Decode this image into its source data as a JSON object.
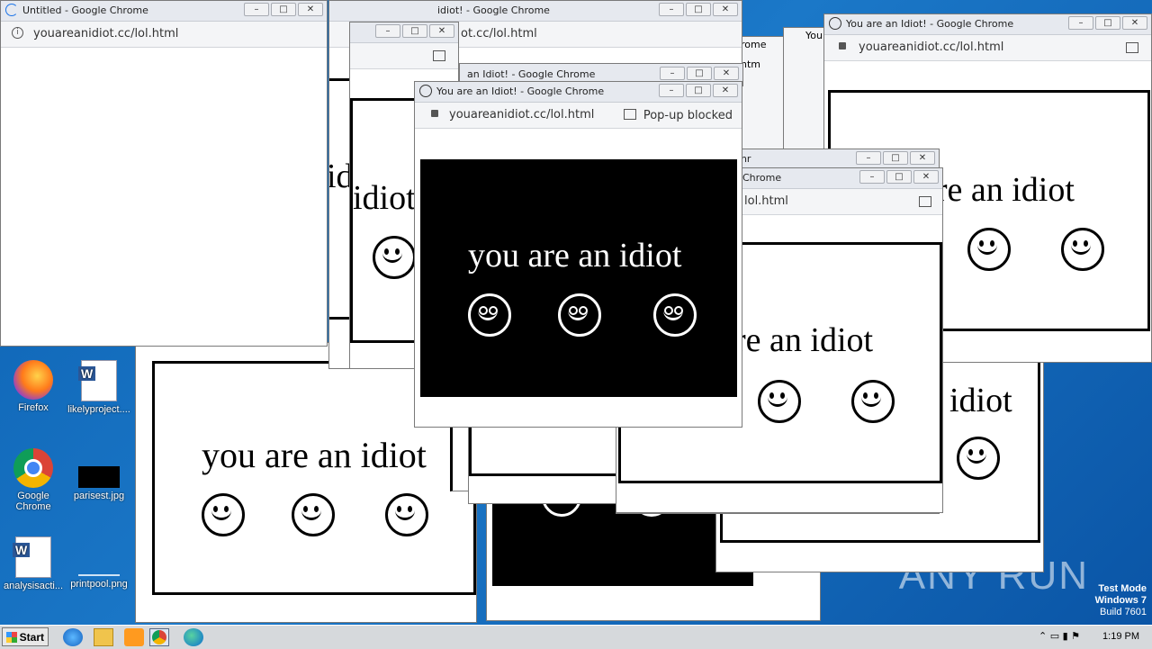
{
  "desktop": {
    "watermark": "ANY RUN",
    "test_mode": [
      "Test Mode",
      "Windows 7",
      "Build 7601"
    ],
    "icons": [
      {
        "label": "Firefox",
        "icon": "firefox-icon"
      },
      {
        "label": "likelyproject....",
        "icon": "word-doc-icon"
      },
      {
        "label": "Google Chrome",
        "icon": "chrome-icon"
      },
      {
        "label": "parisest.jpg",
        "icon": "image-file-icon"
      },
      {
        "label": "analysisacti...",
        "icon": "word-doc-icon"
      },
      {
        "label": "printpool.png",
        "icon": "image-file-icon"
      }
    ]
  },
  "windows": {
    "untitled": {
      "title": "Untitled - Google Chrome",
      "url": "youareanidiot.cc/lol.html"
    },
    "main": {
      "title": "You are an Idiot! - Google Chrome",
      "url": "youareanidiot.cc/lol.html",
      "popup": "Pop-up blocked"
    },
    "right": {
      "title": "You are an Idiot! - Google Chrome",
      "url": "youareanidiot.cc/lol.html"
    },
    "mid_right_title": "Chrome",
    "mid_right_url": "lol.html",
    "behind_title_a": "idiot! - Google Chrome",
    "behind_url_a": "ot.cc/lol.html",
    "behind_title_b": "an Idiot! - Google Chrome",
    "behind_small_a": "rome",
    "behind_small_b": "ntm",
    "behind_small_c": "You",
    "behind_small_d": "e Chr"
  },
  "page_text": {
    "idiot": "you are an idiot",
    "idiot_partial_1": "are an idiot",
    "idiot_partial_2": "re an idiot",
    "idiot_partial_3": "idiot",
    "idiot_partial_4": "id"
  },
  "taskbar": {
    "start": "Start",
    "clock": "1:19 PM",
    "pinned": [
      "ie-icon",
      "explorer-icon",
      "media-player-icon",
      "chrome-icon",
      "edge-icon"
    ]
  },
  "colors": {
    "desktop": "#1b78c8",
    "titlebar": "#e6e9ef",
    "taskbar": "#d6d9dc"
  }
}
